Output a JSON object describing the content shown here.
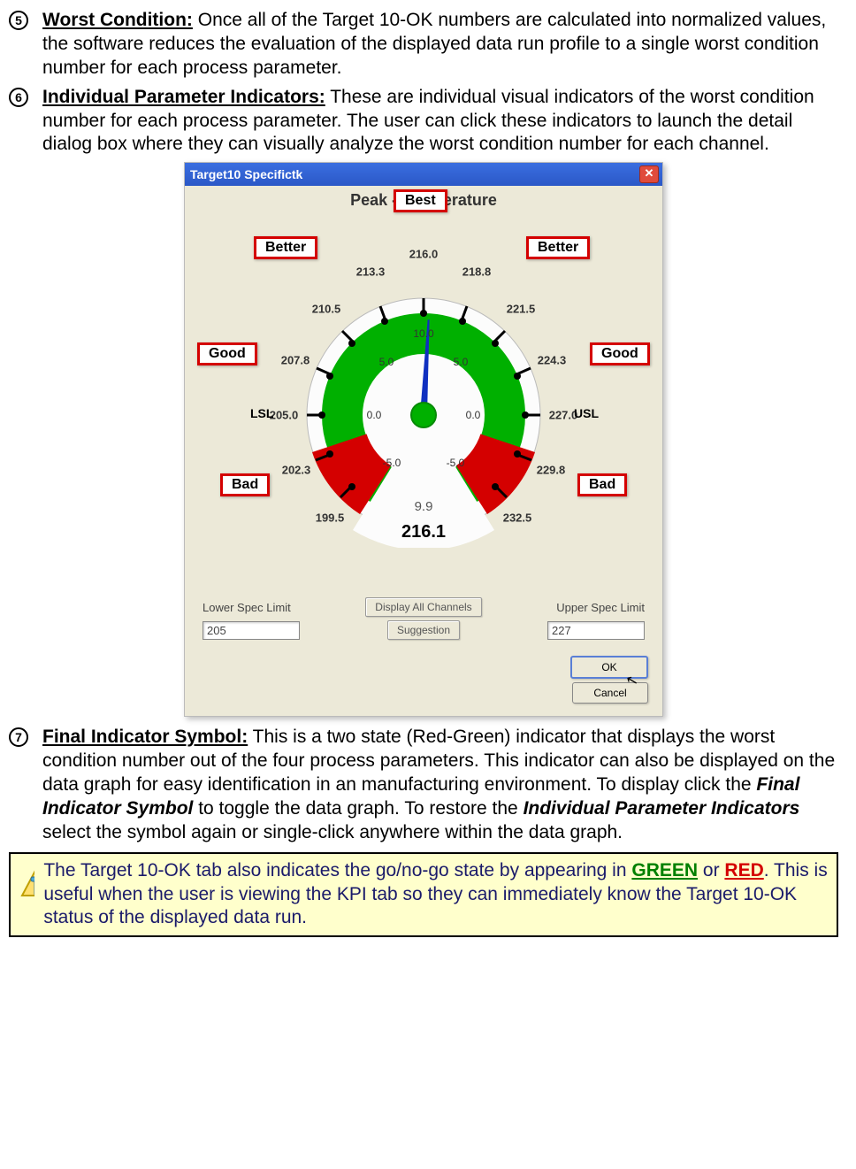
{
  "items": {
    "five": {
      "num": "5",
      "title": "Worst Condition:",
      "text": " Once all of the Target 10-OK numbers are calculated into normalized values, the software reduces the evaluation of the displayed data run profile to a single worst condition number for each process parameter."
    },
    "six": {
      "num": "6",
      "title": "Individual Parameter Indicators:",
      "text": " These are individual visual indicators of the worst condition number for each process parameter. The user can click these indicators to launch the detail dialog box where they can visually analyze the worst condition number for each channel."
    },
    "seven": {
      "num": "7",
      "title": "Final Indicator Symbol:",
      "text_a": " This is a two state (Red-Green) indicator that displays the worst condition number out of the four process parameters. This indicator can also be displayed on the data graph for easy identification in   an manufacturing environment. To display click the ",
      "text_b": " to toggle the data graph. To restore the ",
      "text_c": " select the symbol again or single-click anywhere within the data graph.",
      "em1": "Final Indicator Symbol",
      "em2": "Individual Parameter Indicators"
    }
  },
  "dialog": {
    "title_prefix": "Target10 Specifictk",
    "close_glyph": "✕",
    "chart_title": "Peak - Temperature",
    "ticks": {
      "t0": "216.0",
      "t1": "218.8",
      "t2": "221.5",
      "t3": "224.3",
      "t4": "227.0",
      "t5": "229.8",
      "t6": "232.5",
      "t7": "199.5",
      "t8": "202.3",
      "t9": "205.0",
      "t10": "207.8",
      "t11": "210.5",
      "t12": "213.3"
    },
    "inner": {
      "i0": "10.0",
      "i1": "5.0",
      "i2": "0.0",
      "i3": "-5.0",
      "i4": "-5.0",
      "i5": "0.0",
      "i6": "5.0"
    },
    "lsl": "LSL",
    "usl": "USL",
    "value_small": "9.9",
    "value_big": "216.1",
    "callouts": {
      "best": "Best",
      "better_l": "Better",
      "better_r": "Better",
      "good_l": "Good",
      "good_r": "Good",
      "bad_l": "Bad",
      "bad_r": "Bad"
    },
    "controls": {
      "lsl_label": "Lower Spec Limit",
      "usl_label": "Upper Spec Limit",
      "lsl_value": "205",
      "usl_value": "227",
      "btn_all": "Display All Channels",
      "btn_suggest": "Suggestion",
      "ok": "OK",
      "cancel": "Cancel"
    }
  },
  "note": {
    "text_a": "The Target 10-OK tab also indicates the go/no-go state by appearing in ",
    "green": "GREEN",
    "or": " or ",
    "red": "RED",
    "text_b": ". This is useful when the user is viewing the KPI tab so they can immediately know the Target 10-OK status of the displayed data run."
  },
  "chart_data": {
    "type": "radial-gauge",
    "title": "Peak - Temperature",
    "scale": {
      "lsl": 205.0,
      "usl": 227.0,
      "center": 216.0
    },
    "tick_values": [
      199.5,
      202.3,
      205.0,
      207.8,
      210.5,
      213.3,
      216.0,
      218.8,
      221.5,
      224.3,
      227.0,
      229.8,
      232.5
    ],
    "band_values": [
      -5.0,
      0.0,
      5.0,
      10.0,
      5.0,
      0.0,
      -5.0
    ],
    "bands": [
      {
        "name": "Bad",
        "color": "#d00000",
        "range_deg": [
          210,
          247.5
        ]
      },
      {
        "name": "Good",
        "color": "#00b000",
        "range_deg": [
          247.5,
          285
        ]
      },
      {
        "name": "Better",
        "color": "#00b000",
        "range_deg": [
          285,
          322.5
        ]
      },
      {
        "name": "Best",
        "color": "#00b000",
        "range_deg": [
          322.5,
          37.5
        ]
      },
      {
        "name": "Better",
        "color": "#00b000",
        "range_deg": [
          37.5,
          75
        ]
      },
      {
        "name": "Good",
        "color": "#00b000",
        "range_deg": [
          75,
          112.5
        ]
      },
      {
        "name": "Bad",
        "color": "#d00000",
        "range_deg": [
          112.5,
          150
        ]
      }
    ],
    "needle_value": 216.1,
    "secondary_value": 9.9
  }
}
